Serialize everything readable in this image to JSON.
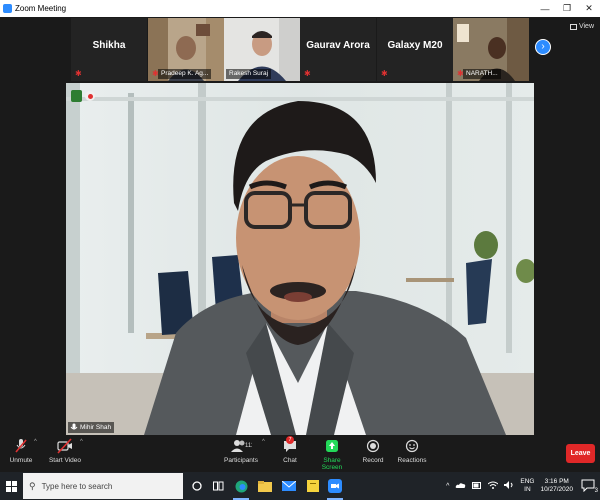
{
  "window": {
    "title": "Zoom Meeting"
  },
  "gallery": {
    "view_label": "View",
    "tiles": [
      {
        "name": "Shikha",
        "label": ""
      },
      {
        "name": "",
        "label": "Pradeep K. Ag..."
      },
      {
        "name": "",
        "label": "Rakesh Suraj"
      },
      {
        "name": "Gaurav Arora",
        "label": ""
      },
      {
        "name": "Galaxy M20",
        "label": ""
      },
      {
        "name": "",
        "label": "NARATH..."
      }
    ]
  },
  "speaker": {
    "label": "Mihir Shah"
  },
  "toolbar": {
    "unmute": "Unmute",
    "start_video": "Start Video",
    "participants": "Participants",
    "participants_count": "111",
    "chat": "Chat",
    "chat_badge": "7",
    "share_screen": "Share Screen",
    "record": "Record",
    "reactions": "Reactions",
    "leave": "Leave"
  },
  "taskbar": {
    "search_placeholder": "Type here to search",
    "language_line1": "ENG",
    "language_line2": "IN",
    "time": "3:16 PM",
    "date": "10/27/2020",
    "notification_count": "3"
  },
  "colors": {
    "zoom_blue": "#2d8cff",
    "share_green": "#23d959",
    "leave_red": "#e02828",
    "muted_red": "#e03131"
  }
}
